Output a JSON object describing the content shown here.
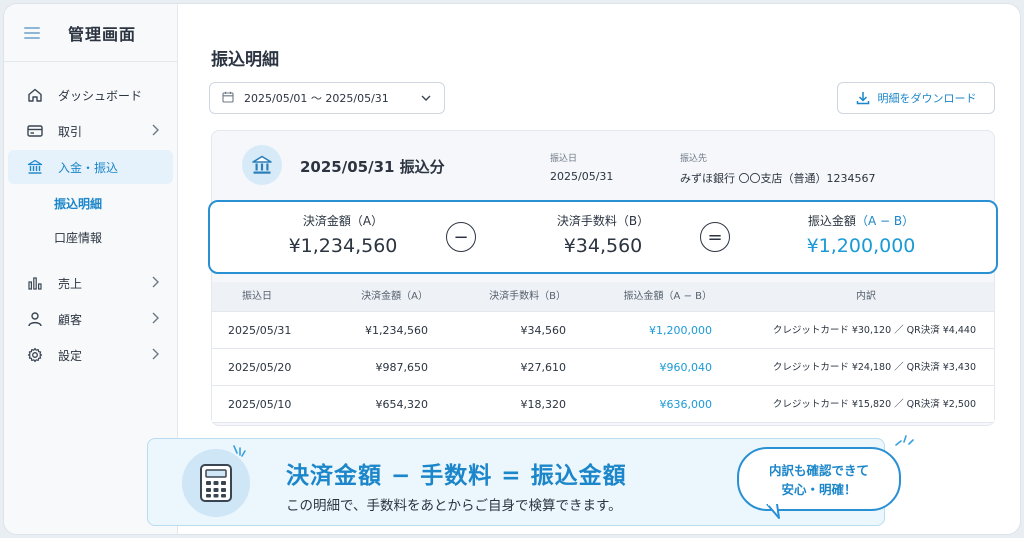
{
  "sidebar": {
    "title": "管理画面",
    "items": [
      {
        "label": "ダッシュボード",
        "icon": "home-icon"
      },
      {
        "label": "取引",
        "icon": "card-icon"
      },
      {
        "label": "入金・振込",
        "icon": "bank-icon"
      },
      {
        "label": "売上",
        "icon": "bar-chart-icon"
      },
      {
        "label": "顧客",
        "icon": "user-icon"
      },
      {
        "label": "設定",
        "icon": "gear-icon"
      }
    ],
    "sub_items": [
      "振込明細",
      "口座情報"
    ]
  },
  "main": {
    "title": "振込明細",
    "date_range": "2025/05/01 〜 2025/05/31",
    "download_label": "明細をダウンロード"
  },
  "summary": {
    "heading": "2025/05/31 振込分",
    "transfer_date_label": "振込日",
    "transfer_date": "2025/05/31",
    "destination_label": "振込先",
    "destination": "みずほ銀行 〇〇支店（普通）1234567"
  },
  "formula": {
    "settlement_label": "決済金額（A）",
    "settlement_value": "¥1,234,560",
    "minus": "−",
    "fee_label": "決済手数料（B）",
    "fee_value": "¥34,560",
    "equals": "=",
    "transfer_label": "振込金額",
    "transfer_label_accent": "（A − B）",
    "transfer_value": "¥1,200,000"
  },
  "table": {
    "headers": [
      "振込日",
      "決済金額（A）",
      "決済手数料（B）",
      "振込金額（A − B）",
      "内訳"
    ],
    "rows": [
      [
        "2025/05/31",
        "¥1,234,560",
        "¥34,560",
        "¥1,200,000",
        "クレジットカード ¥30,120 ／ QR決済 ¥4,440"
      ],
      [
        "2025/05/20",
        "¥987,650",
        "¥27,610",
        "¥960,040",
        "クレジットカード ¥24,180 ／ QR決済 ¥3,430"
      ],
      [
        "2025/05/10",
        "¥654,320",
        "¥18,320",
        "¥636,000",
        "クレジットカード ¥15,820 ／ QR決済 ¥2,500"
      ]
    ]
  },
  "banner": {
    "formula": "決済金額 − 手数料 = 振込金額",
    "subtext": "この明細で、手数料をあとからご自身で検算できます。",
    "bubble_line1": "内訳も確認できて",
    "bubble_line2": "安心・明確！"
  },
  "colors": {
    "accent": "#1b86c9",
    "accent_light": "#e6f2fb",
    "border_highlight": "#2a90d4"
  }
}
